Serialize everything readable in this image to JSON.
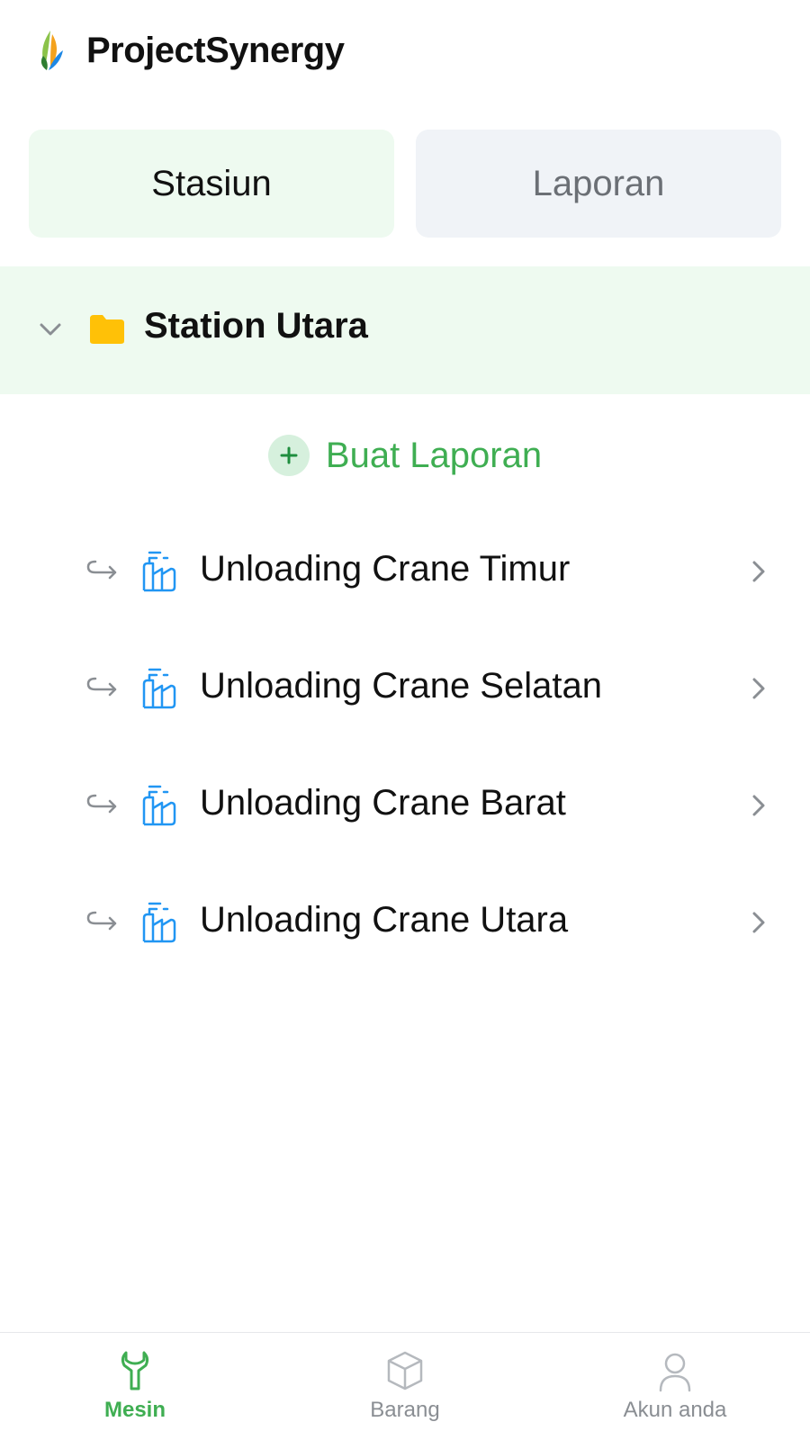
{
  "app": {
    "title": "ProjectSynergy",
    "accent_color": "#3fae52",
    "logo_icon": "leaf-logo-icon"
  },
  "tabs": [
    {
      "label": "Stasiun",
      "active": true
    },
    {
      "label": "Laporan",
      "active": false
    }
  ],
  "station": {
    "name": "Station Utara",
    "expanded": true,
    "folder_color": "#ffc107"
  },
  "create_report": {
    "label": "Buat Laporan",
    "icon": "plus-icon"
  },
  "machines": [
    {
      "name": "Unloading Crane Timur"
    },
    {
      "name": "Unloading Crane Selatan"
    },
    {
      "name": "Unloading Crane Barat"
    },
    {
      "name": "Unloading Crane Utara"
    }
  ],
  "bottom_nav": [
    {
      "label": "Mesin",
      "icon": "wrench-icon",
      "active": true
    },
    {
      "label": "Barang",
      "icon": "box-icon",
      "active": false
    },
    {
      "label": "Akun anda",
      "icon": "user-icon",
      "active": false
    }
  ]
}
